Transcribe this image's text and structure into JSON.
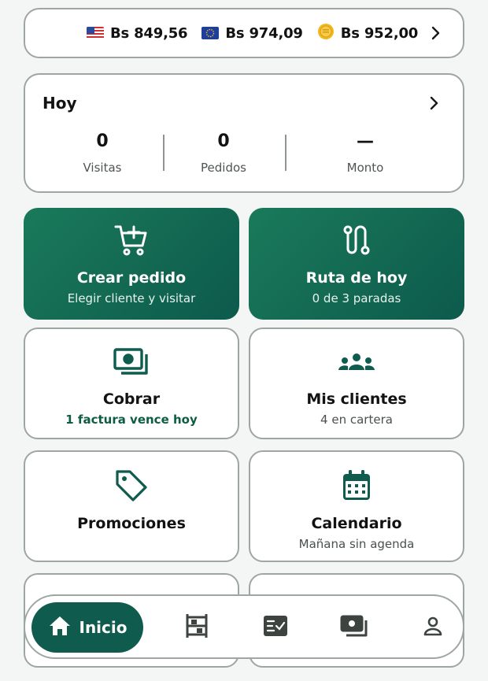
{
  "rates": {
    "usd": {
      "flag_icon": "us-flag-icon",
      "value": "Bs 849,56"
    },
    "eur": {
      "flag_icon": "eu-flag-icon",
      "value": "Bs 974,09"
    },
    "coin": {
      "flag_icon": "coin-icon",
      "value": "Bs 952,00"
    }
  },
  "today": {
    "title": "Hoy",
    "stats": [
      {
        "value": "0",
        "label": "Visitas"
      },
      {
        "value": "0",
        "label": "Pedidos"
      },
      {
        "value": "—",
        "label": "Monto"
      }
    ]
  },
  "tiles": [
    {
      "title": "Crear pedido",
      "subtitle": "Elegir cliente y visitar",
      "icon": "cart-plus-icon"
    },
    {
      "title": "Ruta de hoy",
      "subtitle": "0 de 3 paradas",
      "icon": "route-icon"
    },
    {
      "title": "Cobrar",
      "subtitle": "1 factura vence hoy",
      "icon": "cash-icon"
    },
    {
      "title": "Mis clientes",
      "subtitle": "4 en cartera",
      "icon": "group-icon"
    },
    {
      "title": "Promociones",
      "subtitle": "",
      "icon": "tag-icon"
    },
    {
      "title": "Calendario",
      "subtitle": "Mañana sin agenda",
      "icon": "calendar-icon"
    }
  ],
  "nav": {
    "home_label": "Inicio",
    "items": [
      "home-icon",
      "shelves-icon",
      "checklist-icon",
      "money-icon",
      "profile-icon"
    ]
  },
  "colors": {
    "brand_green": "#0f5c4e",
    "accent_text": "#0f5c45",
    "border": "#9ea6a2",
    "background": "#f3f6f4"
  }
}
